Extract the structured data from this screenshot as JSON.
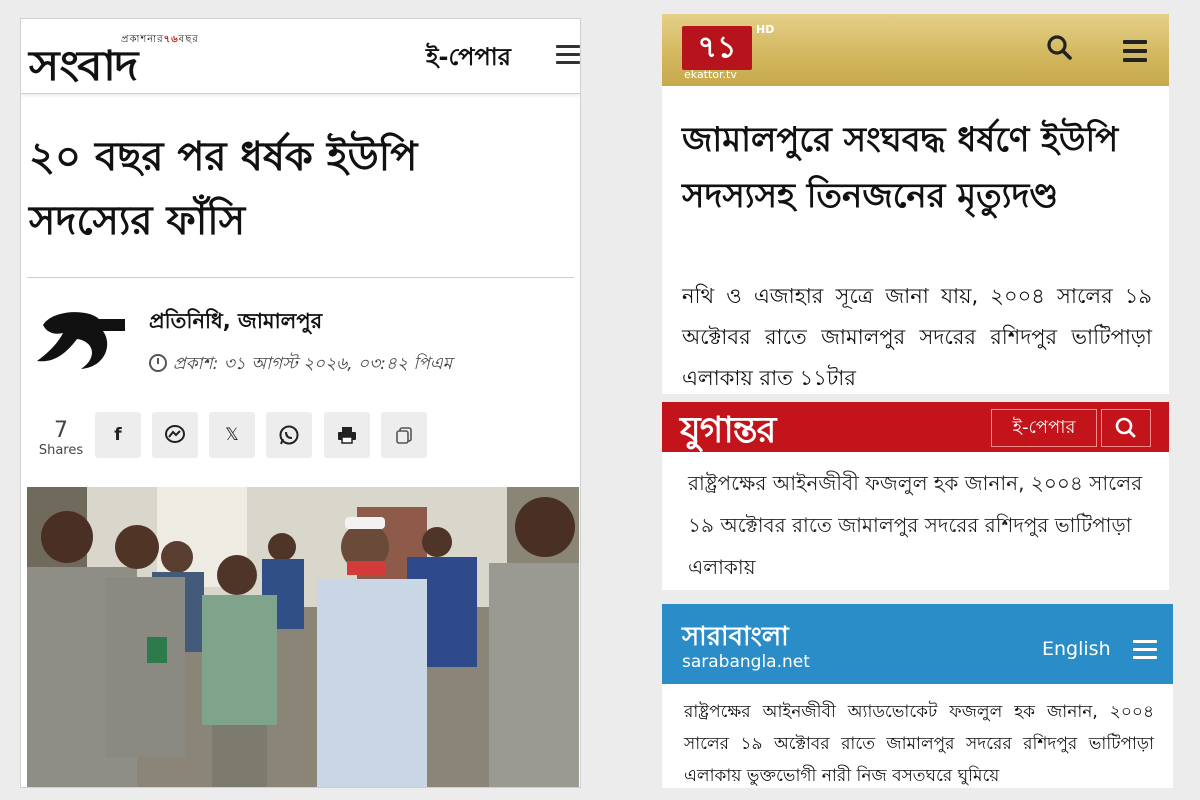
{
  "sangbad": {
    "logo": "সংবাদ",
    "tagline_pre": "প্রকাশনার",
    "tagline_num": "৭৬",
    "tagline_post": "বছর",
    "epaper_label": "ই-পেপার",
    "menu_icon": "hamburger-icon",
    "headline": "২০ বছর পর ধর্ষক ইউপি সদস্যের ফাঁসি",
    "author": "প্রতিনিধি, জামালপুর",
    "published": "প্রকাশ: ৩১ আগস্ট ২০২৬, ০৩:৪২ পিএম",
    "share_count": "7",
    "shares_label": "Shares",
    "share_buttons": [
      {
        "icon": "facebook-icon",
        "glyph": "f"
      },
      {
        "icon": "messenger-icon",
        "glyph": "m"
      },
      {
        "icon": "x-icon",
        "glyph": "𝕏"
      },
      {
        "icon": "whatsapp-icon",
        "glyph": "w"
      },
      {
        "icon": "print-icon",
        "glyph": "🖶"
      },
      {
        "icon": "copy-icon",
        "glyph": "⧉"
      }
    ],
    "colors": {
      "accent": "#c0171d"
    }
  },
  "ekattor": {
    "logo_text": "৭১",
    "hd_badge": "HD",
    "domain": "ekattor.tv",
    "headline": "জামালপুরে সংঘবদ্ধ ধর্ষণে ইউপি সদস্যসহ তিনজনের মৃত্যুদণ্ড",
    "body": "নথি ও এজাহার সূত্রে জানা যায়, ২০০৪ সালের ১৯ অক্টোবর রাতে জামালপুর সদরের রশিদপুর ভাটিপাড়া এলাকায় রাত ১১টার",
    "colors": {
      "header": "#d2b65c",
      "logo_bg": "#b6131c"
    }
  },
  "jugantor": {
    "logo": "যুগান্তর",
    "epaper_label": "ই-পেপার",
    "body": "রাষ্ট্রপক্ষের আইনজীবী ফজলুল হক জানান, ২০০৪ সালের ১৯ অক্টোবর রাতে জামালপুর সদরের রশিদপুর ভাটিপাড়া এলাকায়",
    "colors": {
      "header": "#c3141b"
    }
  },
  "sarabangla": {
    "logo": "সারাবাংলা",
    "domain": "sarabangla.net",
    "english_label": "English",
    "body": "রাষ্ট্রপক্ষের আইনজীবী অ্যাডভোকেট ফজলুল হক জানান, ২০০৪ সালের ১৯ অক্টোবর রাতে জামালপুর সদরের রশিদপুর ভাটিপাড়া এলাকায় ভুক্তভোগী নারী নিজ বসতঘরে ঘুমিয়ে",
    "colors": {
      "header": "#2a8dc7"
    }
  }
}
